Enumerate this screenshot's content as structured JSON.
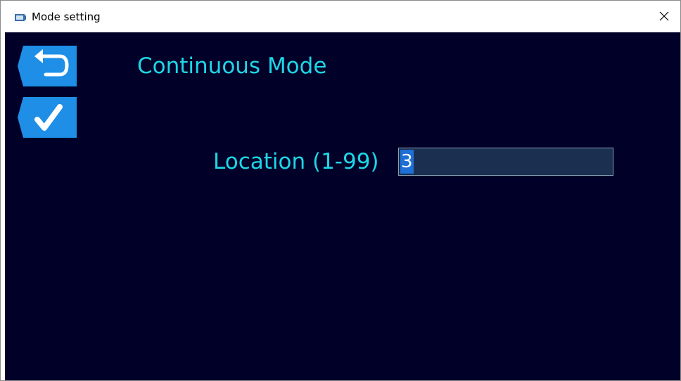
{
  "window": {
    "title": "Mode setting",
    "app_icon": "window-app-icon",
    "close_icon": "close-icon"
  },
  "toolbar": {
    "back_icon": "back-arrow-icon",
    "confirm_icon": "checkmark-icon",
    "button_color": "#1e8ee6"
  },
  "main": {
    "mode_title": "Continuous Mode",
    "location_label": "Location (1-99)",
    "location_value": "3",
    "text_color": "#1ed6e6",
    "background_color": "#000028"
  }
}
